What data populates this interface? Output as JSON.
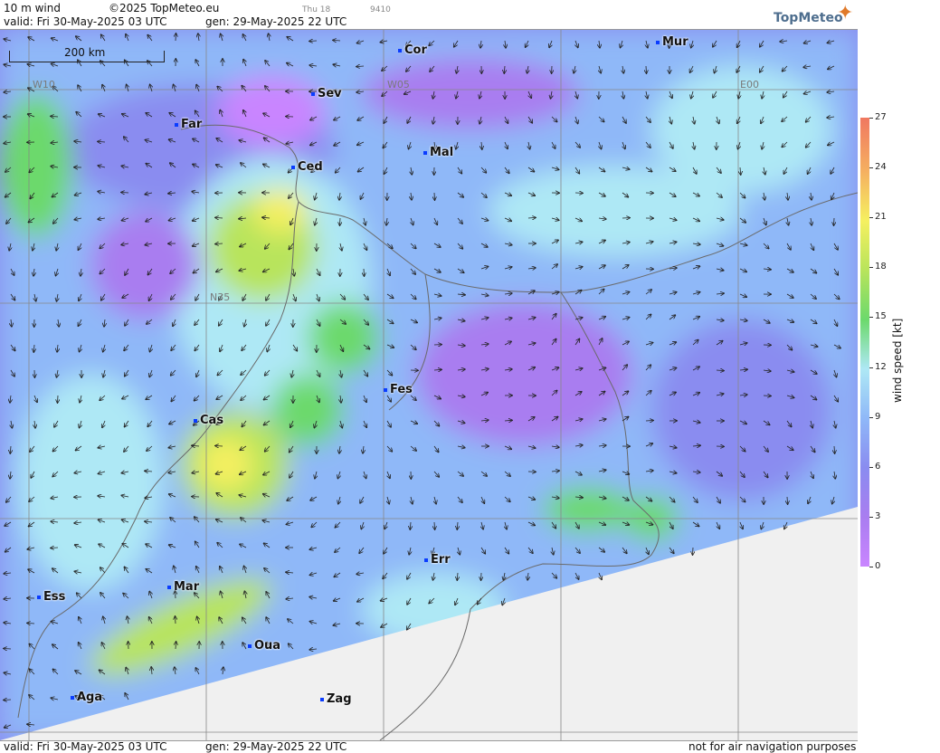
{
  "header": {
    "product": "10 m wind",
    "copyright": "©2025 TopMeteo.eu",
    "small_day": "Thu 18",
    "small_code": "9410",
    "valid": "valid:  Fri  30-May-2025  03 UTC",
    "gen": "gen: 29-May-2025 22 UTC",
    "logo": "TopMeteo"
  },
  "footer": {
    "valid": "valid:  Fri  30-May-2025  03 UTC",
    "gen": "gen: 29-May-2025 22 UTC",
    "disclaimer": "not for air navigation purposes"
  },
  "scale_label": "200 km",
  "grid_labels": [
    "W10",
    "W05",
    "E00",
    "N35"
  ],
  "cities": [
    "Cor",
    "Mur",
    "Sev",
    "Far",
    "Ced",
    "Mal",
    "Fes",
    "Cas",
    "Err",
    "Mar",
    "Ess",
    "Oua",
    "Aga",
    "Zag"
  ],
  "legend": {
    "title": "wind speed [kt]",
    "ticks": [
      "27",
      "24",
      "21",
      "18",
      "15",
      "12",
      "9",
      "6",
      "3",
      "0"
    ],
    "colors": [
      "#f07860",
      "#f5b060",
      "#f5f060",
      "#b8e45c",
      "#6cd96c",
      "#aee8f5",
      "#8fb8f8",
      "#8a8cf0",
      "#a97df0",
      "#c985ff"
    ]
  },
  "colors": {
    "city_marker": "#0a3cff",
    "no_data": "#f0f0f0"
  }
}
